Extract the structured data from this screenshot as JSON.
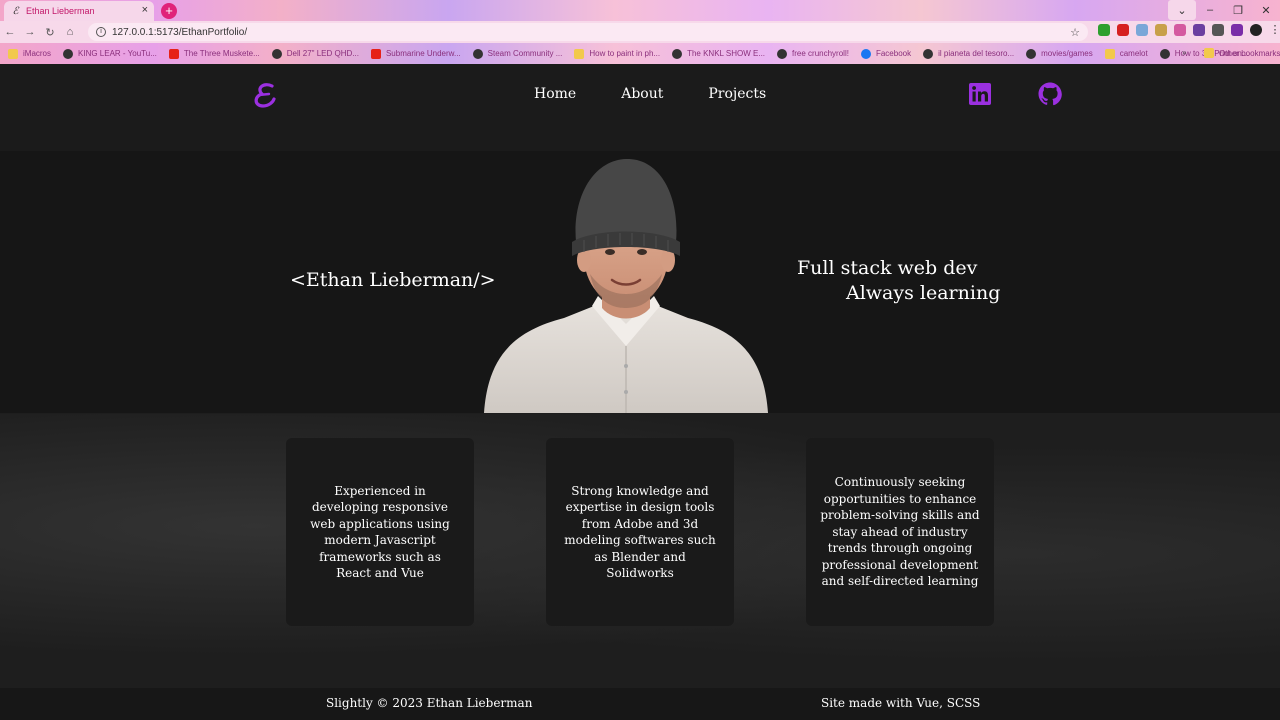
{
  "browser": {
    "tab_title": "Ethan Lieberman",
    "url": "127.0.0.1:5173/EthanPortfolio/",
    "bookmarks": [
      "iMacros",
      "KING LEAR - YouTu...",
      "The Three Muskete...",
      "Dell 27\" LED QHD...",
      "Submarine Underw...",
      "Steam Community ...",
      "How to paint in ph...",
      "The KNKL SHOW E...",
      "free crunchyroll!",
      "Facebook",
      "il pianeta del tesoro...",
      "movies/games",
      "camelot",
      "How to 3D Print on..."
    ],
    "other_bookmarks": "Other bookmarks",
    "bookmarks_more": "»"
  },
  "nav": {
    "links": [
      "Home",
      "About",
      "Projects"
    ]
  },
  "hero": {
    "name": "<Ethan Lieberman/>",
    "tagline_1": "Full stack web dev",
    "tagline_2": "Always learning"
  },
  "cards": [
    "Experienced in developing responsive web applications using modern Javascript frameworks such as React and Vue",
    "Strong knowledge and expertise in design tools from Adobe and 3d modeling softwares such as Blender and Solidworks",
    "Continuously seeking opportunities to enhance problem-solving skills and stay ahead of industry trends through ongoing professional development and self-directed learning"
  ],
  "footer": {
    "left": "Slightly © 2023 Ethan Lieberman",
    "right": "Site made with Vue, SCSS"
  },
  "colors": {
    "accent": "#9b30e0",
    "background": "#1e1e1e"
  }
}
